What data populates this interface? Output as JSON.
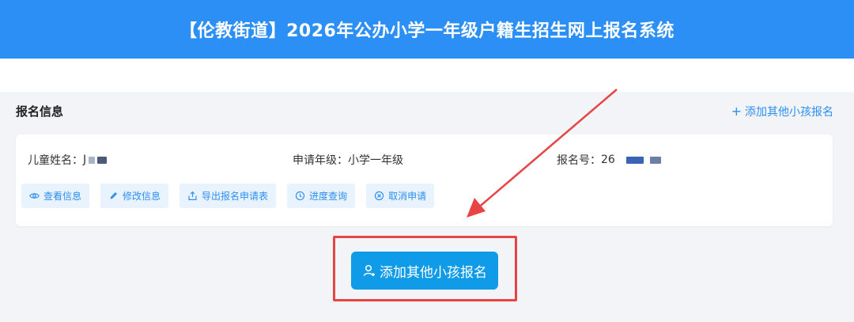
{
  "header": {
    "title": "【伦教街道】2026年公办小学一年级户籍生招生网上报名系统"
  },
  "section": {
    "title": "报名信息",
    "add_link": "添加其他小孩报名"
  },
  "record": {
    "child_name_label": "儿童姓名：",
    "child_name_value": "J",
    "grade_label": "申请年级：",
    "grade_value": "小学一年级",
    "reg_no_label": "报名号：",
    "reg_no_value": "26"
  },
  "actions": [
    {
      "label": "查看信息",
      "icon": "eye-icon"
    },
    {
      "label": "修改信息",
      "icon": "pencil-icon"
    },
    {
      "label": "导出报名申请表",
      "icon": "export-icon"
    },
    {
      "label": "进度查询",
      "icon": "clock-icon"
    },
    {
      "label": "取消申请",
      "icon": "cancel-icon"
    }
  ],
  "main_button": {
    "label": "添加其他小孩报名",
    "icon": "user-add-icon"
  },
  "colors": {
    "brand": "#2c8ff5",
    "primary_button": "#0f9be8",
    "highlight": "#e74545",
    "action_bg": "#e8f3fd"
  }
}
